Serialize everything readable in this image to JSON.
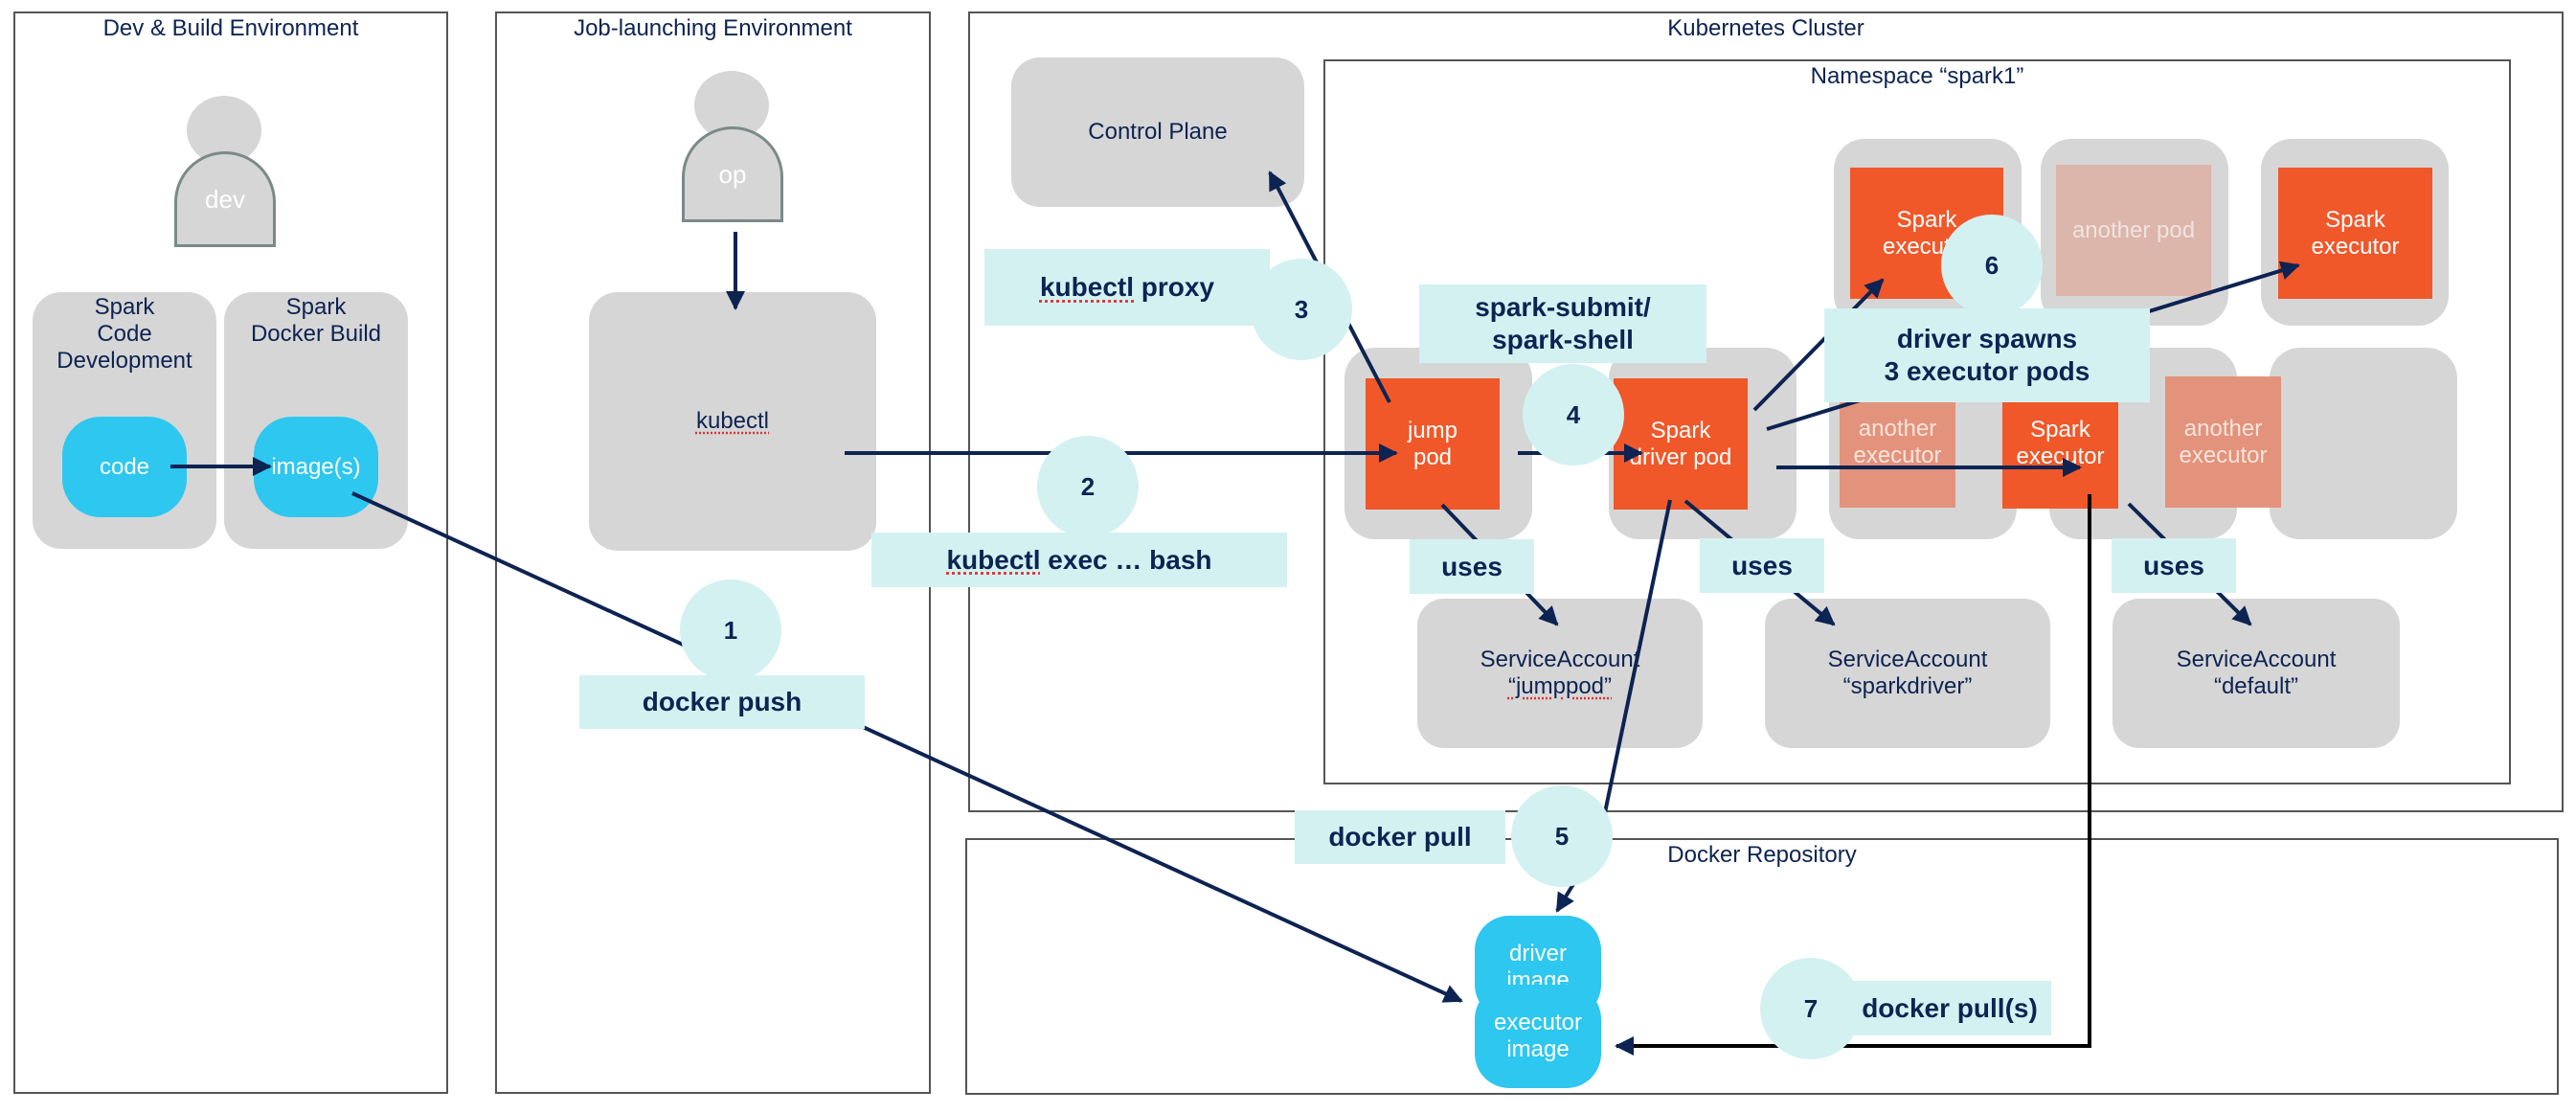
{
  "environments": {
    "dev": {
      "title": "Dev & Build Environment",
      "person": "dev",
      "code_dev": {
        "title": "Spark\nCode\nDevelopment",
        "item": "code"
      },
      "docker_build": {
        "title": "Spark\nDocker Build",
        "item": "image(s)"
      }
    },
    "job": {
      "title": "Job-launching Environment",
      "person": "op",
      "tool": "kubectl"
    },
    "k8s": {
      "title": "Kubernetes Cluster",
      "control_plane": "Control Plane",
      "namespace": {
        "title": "Namespace “spark1”",
        "pods": {
          "jump": "jump\npod",
          "driver": "Spark\ndriver pod",
          "exec_top": "Spark\nexecutor",
          "another_pod": "another pod",
          "exec_top_right": "Spark\nexecutor",
          "another_exec_1": "another\nexecutor",
          "exec_mid": "Spark\nexecutor",
          "another_exec_2": "another\nexecutor"
        },
        "service_accounts": [
          {
            "name": "ServiceAccount",
            "id": "“jumppod”"
          },
          {
            "name": "ServiceAccount",
            "id": "“sparkdriver”"
          },
          {
            "name": "ServiceAccount",
            "id": "“default”"
          }
        ],
        "uses_label": "uses"
      }
    },
    "repo": {
      "title": "Docker Repository",
      "driver_image": "driver\nimage",
      "executor_image": "executor\nimage"
    }
  },
  "steps": [
    {
      "num": "1",
      "label": "docker push"
    },
    {
      "num": "2",
      "label": "kubectl exec … bash"
    },
    {
      "num": "3",
      "label": "kubectl proxy"
    },
    {
      "num": "4",
      "label": "spark-submit/\nspark-shell"
    },
    {
      "num": "5",
      "label": "docker pull"
    },
    {
      "num": "6",
      "label": "driver spawns\n3 executor pods"
    },
    {
      "num": "7",
      "label": "docker pull(s)"
    }
  ],
  "colors": {
    "text": "#0d2352",
    "active_pod": "#f0582a",
    "faded_pod": "#e3937b",
    "image_pill": "#2dc7ef",
    "step_label": "#d4f1f2",
    "container": "#d6d6d6"
  }
}
